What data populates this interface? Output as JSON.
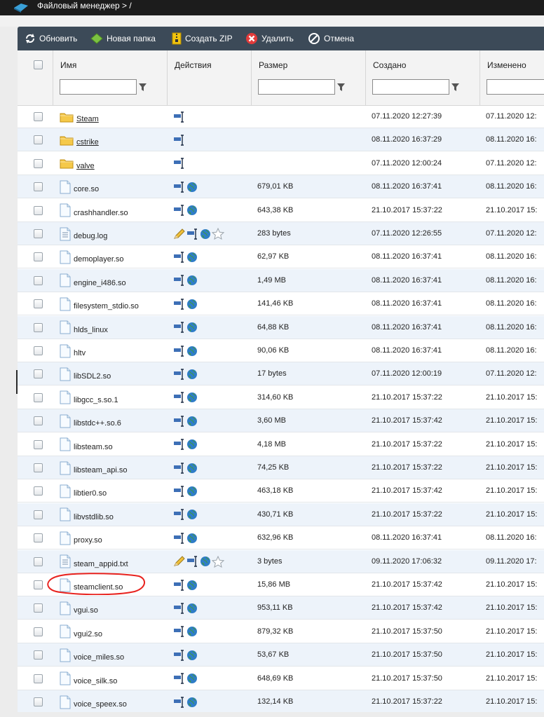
{
  "window": {
    "title": "Файловый менеджер > /"
  },
  "toolbar": {
    "refresh": "Обновить",
    "new_folder": "Новая папка",
    "create_zip": "Создать ZIP",
    "delete": "Удалить",
    "cancel": "Отмена"
  },
  "columns": {
    "name": "Имя",
    "actions": "Действия",
    "size": "Размер",
    "created": "Создано",
    "modified": "Изменено"
  },
  "filters": {
    "name": "",
    "size": "",
    "created": "",
    "modified": ""
  },
  "files": [
    {
      "name": "Steam",
      "type": "dir",
      "size": "",
      "created": "07.11.2020 12:27:39",
      "modified": "07.11.2020 12:"
    },
    {
      "name": "cstrike",
      "type": "dir",
      "size": "",
      "created": "08.11.2020 16:37:29",
      "modified": "08.11.2020 16:"
    },
    {
      "name": "valve",
      "type": "dir",
      "size": "",
      "created": "07.11.2020 12:00:24",
      "modified": "07.11.2020 12:"
    },
    {
      "name": "core.so",
      "type": "file",
      "size": "679,01 KB",
      "created": "08.11.2020 16:37:41",
      "modified": "08.11.2020 16:"
    },
    {
      "name": "crashhandler.so",
      "type": "file",
      "size": "643,38 KB",
      "created": "21.10.2017 15:37:22",
      "modified": "21.10.2017 15:"
    },
    {
      "name": "debug.log",
      "type": "text",
      "size": "283 bytes",
      "created": "07.11.2020 12:26:55",
      "modified": "07.11.2020 12:"
    },
    {
      "name": "demoplayer.so",
      "type": "file",
      "size": "62,97 KB",
      "created": "08.11.2020 16:37:41",
      "modified": "08.11.2020 16:"
    },
    {
      "name": "engine_i486.so",
      "type": "file",
      "size": "1,49 MB",
      "created": "08.11.2020 16:37:41",
      "modified": "08.11.2020 16:"
    },
    {
      "name": "filesystem_stdio.so",
      "type": "file",
      "size": "141,46 KB",
      "created": "08.11.2020 16:37:41",
      "modified": "08.11.2020 16:"
    },
    {
      "name": "hlds_linux",
      "type": "file",
      "size": "64,88 KB",
      "created": "08.11.2020 16:37:41",
      "modified": "08.11.2020 16:"
    },
    {
      "name": "hltv",
      "type": "file",
      "size": "90,06 KB",
      "created": "08.11.2020 16:37:41",
      "modified": "08.11.2020 16:"
    },
    {
      "name": "libSDL2.so",
      "type": "file",
      "size": "17 bytes",
      "created": "07.11.2020 12:00:19",
      "modified": "07.11.2020 12:"
    },
    {
      "name": "libgcc_s.so.1",
      "type": "file",
      "size": "314,60 KB",
      "created": "21.10.2017 15:37:22",
      "modified": "21.10.2017 15:"
    },
    {
      "name": "libstdc++.so.6",
      "type": "file",
      "size": "3,60 MB",
      "created": "21.10.2017 15:37:42",
      "modified": "21.10.2017 15:"
    },
    {
      "name": "libsteam.so",
      "type": "file",
      "size": "4,18 MB",
      "created": "21.10.2017 15:37:22",
      "modified": "21.10.2017 15:"
    },
    {
      "name": "libsteam_api.so",
      "type": "file",
      "size": "74,25 KB",
      "created": "21.10.2017 15:37:22",
      "modified": "21.10.2017 15:"
    },
    {
      "name": "libtier0.so",
      "type": "file",
      "size": "463,18 KB",
      "created": "21.10.2017 15:37:42",
      "modified": "21.10.2017 15:"
    },
    {
      "name": "libvstdlib.so",
      "type": "file",
      "size": "430,71 KB",
      "created": "21.10.2017 15:37:22",
      "modified": "21.10.2017 15:"
    },
    {
      "name": "proxy.so",
      "type": "file",
      "size": "632,96 KB",
      "created": "08.11.2020 16:37:41",
      "modified": "08.11.2020 16:"
    },
    {
      "name": "steam_appid.txt",
      "type": "text",
      "size": "3 bytes",
      "created": "09.11.2020 17:06:32",
      "modified": "09.11.2020 17:"
    },
    {
      "name": "steamclient.so",
      "type": "file",
      "size": "15,86 MB",
      "created": "21.10.2017 15:37:42",
      "modified": "21.10.2017 15:"
    },
    {
      "name": "vgui.so",
      "type": "file",
      "size": "953,11 KB",
      "created": "21.10.2017 15:37:42",
      "modified": "21.10.2017 15:"
    },
    {
      "name": "vgui2.so",
      "type": "file",
      "size": "879,32 KB",
      "created": "21.10.2017 15:37:50",
      "modified": "21.10.2017 15:"
    },
    {
      "name": "voice_miles.so",
      "type": "file",
      "size": "53,67 KB",
      "created": "21.10.2017 15:37:50",
      "modified": "21.10.2017 15:"
    },
    {
      "name": "voice_silk.so",
      "type": "file",
      "size": "648,69 KB",
      "created": "21.10.2017 15:37:50",
      "modified": "21.10.2017 15:"
    },
    {
      "name": "voice_speex.so",
      "type": "file",
      "size": "132,14 KB",
      "created": "21.10.2017 15:37:22",
      "modified": "21.10.2017 15:"
    }
  ],
  "annotation": {
    "highlighted_file": "steamclient.so",
    "color": "#e8231f"
  }
}
